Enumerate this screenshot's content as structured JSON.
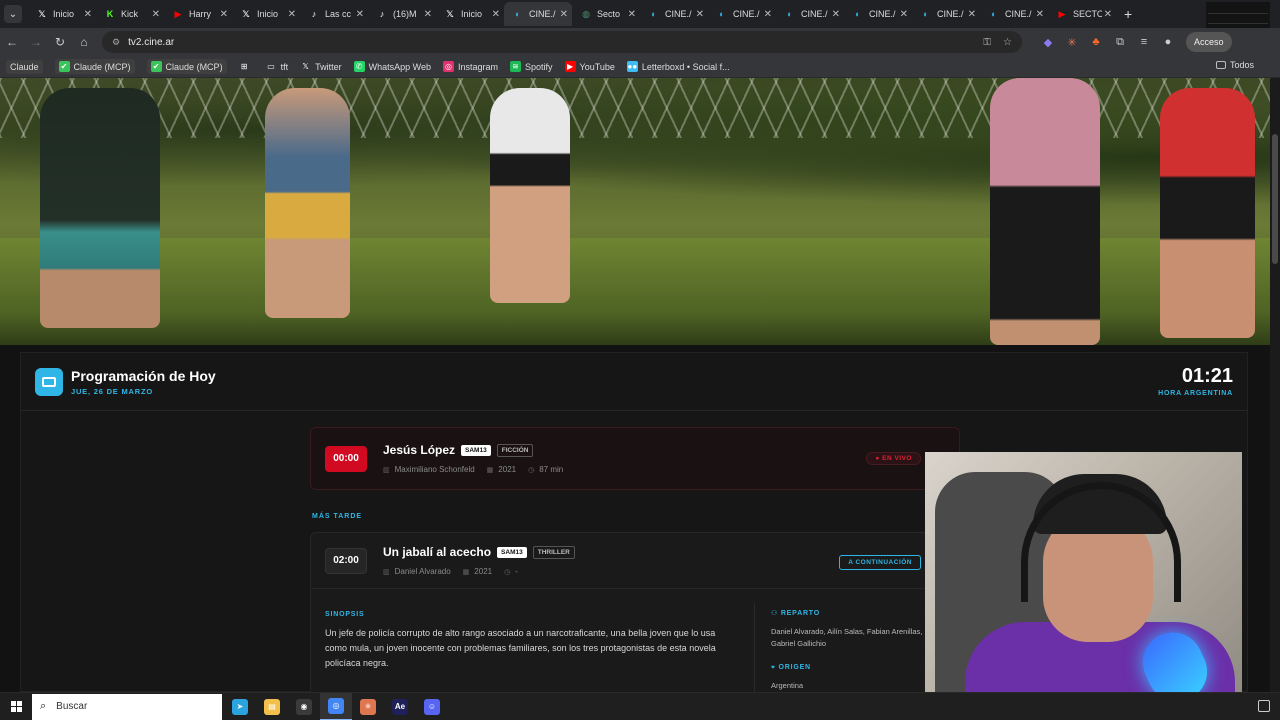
{
  "browser": {
    "tabs": [
      {
        "label": "Inicio",
        "icon": "x-icon",
        "color": "#000000"
      },
      {
        "label": "Kick",
        "icon": "kick-icon",
        "color": "#53fc18"
      },
      {
        "label": "Harry",
        "icon": "youtube-icon",
        "color": "#ff0000"
      },
      {
        "label": "Inicio",
        "icon": "x-icon",
        "color": "#000000"
      },
      {
        "label": "Las cc",
        "icon": "tiktok-icon",
        "color": "#000000"
      },
      {
        "label": "(16)M",
        "icon": "tiktok-icon",
        "color": "#000000"
      },
      {
        "label": "Inicio",
        "icon": "x-icon",
        "color": "#000000"
      },
      {
        "label": "CINE./",
        "icon": "cine-icon",
        "color": "#2fb6e6",
        "active": true
      },
      {
        "label": "Secto",
        "icon": "globe-icon",
        "color": "#4a8f6f"
      },
      {
        "label": "CINE./",
        "icon": "cine-icon",
        "color": "#2fb6e6"
      },
      {
        "label": "CINE./",
        "icon": "cine-icon",
        "color": "#2fb6e6"
      },
      {
        "label": "CINE./",
        "icon": "cine-icon",
        "color": "#2fb6e6"
      },
      {
        "label": "CINE./",
        "icon": "cine-icon",
        "color": "#2fb6e6"
      },
      {
        "label": "CINE./",
        "icon": "cine-icon",
        "color": "#2fb6e6"
      },
      {
        "label": "CINE./",
        "icon": "cine-icon",
        "color": "#2fb6e6"
      },
      {
        "label": "SECTO",
        "icon": "youtube-icon",
        "color": "#ff0000"
      }
    ],
    "url": "tv2.cine.ar",
    "account_label": "Acceso",
    "bookmarks": [
      {
        "label": "Claude",
        "icon": "claude-icon",
        "chip": true
      },
      {
        "label": "Claude (MCP)",
        "icon": "check-icon",
        "chip": true
      },
      {
        "label": "Claude (MCP)",
        "icon": "check-icon",
        "chip": true
      },
      {
        "label": "",
        "icon": "apps-grid-icon"
      },
      {
        "label": "tft",
        "icon": "folder-icon"
      },
      {
        "label": "Twitter",
        "icon": "x-icon"
      },
      {
        "label": "WhatsApp Web",
        "icon": "whatsapp-icon"
      },
      {
        "label": "Instagram",
        "icon": "instagram-icon"
      },
      {
        "label": "Spotify",
        "icon": "spotify-icon"
      },
      {
        "label": "YouTube",
        "icon": "youtube-icon"
      },
      {
        "label": "Letterboxd • Social f...",
        "icon": "letterboxd-icon"
      }
    ],
    "bookmarks_right": "Todos"
  },
  "schedule": {
    "title": "Programación de Hoy",
    "date": "JUE, 26 DE MARZO",
    "clock": "01:21",
    "clock_label": "HORA ARGENTINA",
    "current": {
      "time": "00:00",
      "title": "Jesús López",
      "rating": "SAM13",
      "genre": "FICCIÓN",
      "director": "Maximiliano Schonfeld",
      "year": "2021",
      "duration": "87 min",
      "status": "EN VIVO"
    },
    "later_label": "MÁS TARDE",
    "next": {
      "time": "02:00",
      "title": "Un jabalí al acecho",
      "rating": "SAM13",
      "genre": "THRILLER",
      "director": "Daniel Alvarado",
      "year": "2021",
      "duration": "-",
      "status": "A CONTINUACIÓN",
      "synopsis_label": "SINOPSIS",
      "synopsis": "Un jefe de policía corrupto de alto rango asociado a un narcotraficante, una bella joven que lo usa como mula, un joven inocente con problemas familiares, son los tres protagonistas de esta novela policíaca negra.",
      "cast_label": "REPARTO",
      "cast": "Daniel Alvarado, Ailín Salas, Fabian Arenillas, Gabriel Gallichio",
      "origin_label": "ORIGEN",
      "origin": "Argentina"
    }
  },
  "taskbar": {
    "search_placeholder": "Buscar",
    "apps": [
      {
        "icon": "telegram-icon",
        "color": "#2aa3df",
        "glyph": "➤"
      },
      {
        "icon": "file-explorer-icon",
        "color": "#f2c04b",
        "glyph": "▤"
      },
      {
        "icon": "obs-icon",
        "color": "#3a3a3a",
        "glyph": "◉"
      },
      {
        "icon": "chrome-icon",
        "color": "#4285f4",
        "glyph": "◎",
        "active": true
      },
      {
        "icon": "claude-icon",
        "color": "#e0764f",
        "glyph": "✳"
      },
      {
        "icon": "after-effects-icon",
        "color": "#1f1f5a",
        "glyph": "Ae"
      },
      {
        "icon": "discord-icon",
        "color": "#5865f2",
        "glyph": "☺"
      }
    ]
  }
}
